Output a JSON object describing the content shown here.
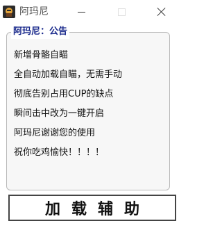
{
  "window": {
    "title": "阿玛尼",
    "controls": {
      "minimize_icon": "minimize-icon",
      "maximize_icon": "maximize-icon",
      "close_icon": "close-icon"
    }
  },
  "notice": {
    "group_title": "阿玛尼：公告",
    "lines": [
      "新增骨骼自瞄",
      "全自动加载自瞄，无需手动",
      "彻底告别占用CUP的缺点",
      "瞬间击中改为一键开启",
      "阿玛尼谢谢您的使用",
      "祝你吃鸡愉快！！！！"
    ]
  },
  "action": {
    "load_label": "加载辅助"
  },
  "colors": {
    "group_title": "#1a2a8c",
    "border": "#b9b9b9"
  }
}
